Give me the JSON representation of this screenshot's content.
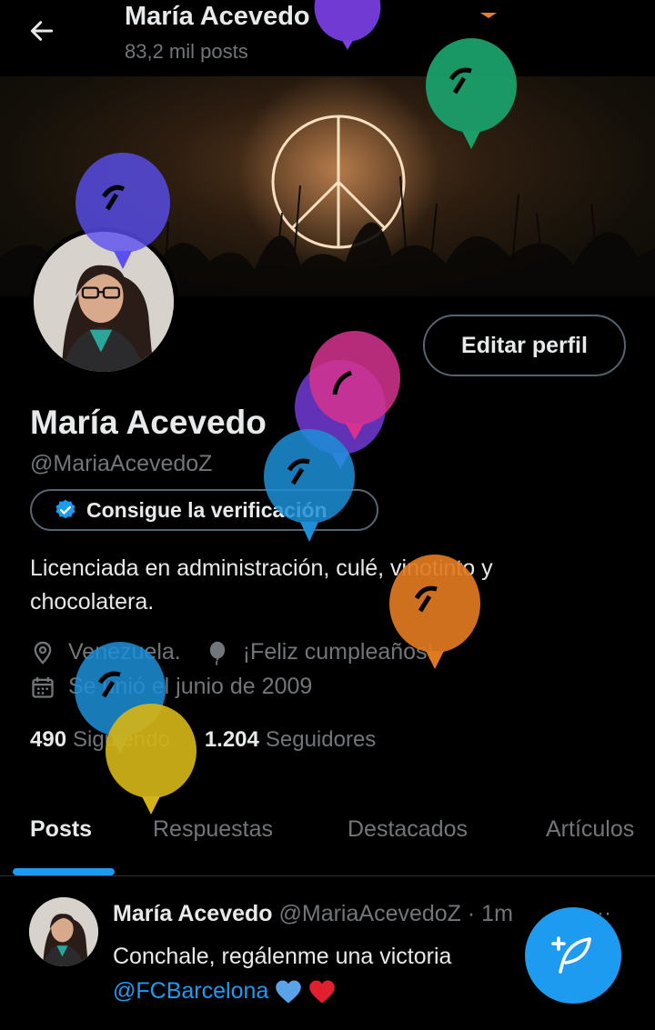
{
  "header": {
    "title": "María Acevedo",
    "post_count": "83,2 mil posts"
  },
  "profile": {
    "edit_button": "Editar perfil",
    "name": "María Acevedo",
    "handle": "@MariaAcevedoZ",
    "verify_button": "Consigue la verificación",
    "bio": "Licenciada en administración, culé, vinotinto y chocolatera.",
    "location": "Venezuela.",
    "birthday": "¡Feliz cumpleaños!",
    "joined": "Se unió el junio de 2009",
    "following_count": "490",
    "following_label": "Siguiendo",
    "followers_count": "1.204",
    "followers_label": "Seguidores"
  },
  "tabs": [
    {
      "label": "Posts",
      "active": true
    },
    {
      "label": "Respuestas",
      "active": false
    },
    {
      "label": "Destacados",
      "active": false
    },
    {
      "label": "Artículos",
      "active": false
    }
  ],
  "post": {
    "author": "María Acevedo",
    "handle_time": "@MariaAcevedoZ · 1m",
    "more": "···",
    "text": "Conchale, regálenme una victoria",
    "mention": "@FCBarcelona"
  },
  "colors": {
    "accent": "#1d9bf0",
    "background": "#000000",
    "balloons": [
      "#7b3fe4",
      "#e8802a",
      "#1a9f6a",
      "#5a4ff0",
      "#d6338f",
      "#7b3fe4",
      "#1d8fd8",
      "#e07a1f",
      "#1d8fd8",
      "#d4b417"
    ]
  },
  "icons": {
    "back": "arrow-left-icon",
    "verified": "verified-badge-icon",
    "location": "location-pin-icon",
    "birthday": "balloon-icon",
    "calendar": "calendar-icon",
    "compose": "feather-plus-icon"
  }
}
